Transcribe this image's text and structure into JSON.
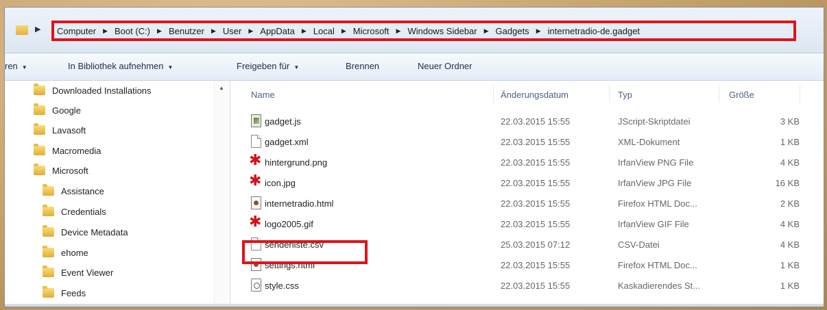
{
  "address_bar": {
    "crumbs": [
      "Computer",
      "Boot (C:)",
      "Benutzer",
      "User",
      "AppData",
      "Local",
      "Microsoft",
      "Windows Sidebar",
      "Gadgets",
      "internetradio-de.gadget"
    ]
  },
  "toolbar": {
    "organize_label": "ren",
    "library_label": "In Bibliothek aufnehmen",
    "share_label": "Freigeben für",
    "burn_label": "Brennen",
    "new_folder_label": "Neuer Ordner"
  },
  "nav": {
    "items": [
      "Downloaded Installations",
      "Google",
      "Lavasoft",
      "Macromedia",
      "Microsoft",
      "Assistance",
      "Credentials",
      "Device Metadata",
      "ehome",
      "Event Viewer",
      "Feeds"
    ]
  },
  "columns": {
    "name": "Name",
    "date": "Änderungsdatum",
    "type": "Typ",
    "size": "Größe"
  },
  "files": [
    {
      "name": "gadget.js",
      "date": "22.03.2015 15:55",
      "type": "JScript-Skriptdatei",
      "size": "3 KB",
      "icon": "script-icon"
    },
    {
      "name": "gadget.xml",
      "date": "22.03.2015 15:55",
      "type": "XML-Dokument",
      "size": "1 KB",
      "icon": "document-icon"
    },
    {
      "name": "hintergrund.png",
      "date": "22.03.2015 15:55",
      "type": "IrfanView PNG File",
      "size": "4 KB",
      "icon": "irfanview-image-icon"
    },
    {
      "name": "icon.jpg",
      "date": "22.03.2015 15:55",
      "type": "IrfanView JPG File",
      "size": "16 KB",
      "icon": "irfanview-image-icon"
    },
    {
      "name": "internetradio.html",
      "date": "22.03.2015 15:55",
      "type": "Firefox HTML Doc...",
      "size": "2 KB",
      "icon": "html-document-icon"
    },
    {
      "name": "logo2005.gif",
      "date": "22.03.2015 15:55",
      "type": "IrfanView GIF File",
      "size": "4 KB",
      "icon": "irfanview-image-icon"
    },
    {
      "name": "senderliste.csv",
      "date": "25.03.2015 07:12",
      "type": "CSV-Datei",
      "size": "4 KB",
      "icon": "document-icon"
    },
    {
      "name": "settings.html",
      "date": "22.03.2015 15:55",
      "type": "Firefox HTML Doc...",
      "size": "1 KB",
      "icon": "html-document-icon"
    },
    {
      "name": "style.css",
      "date": "22.03.2015 15:55",
      "type": "Kaskadierendes St...",
      "size": "1 KB",
      "icon": "css-document-icon"
    }
  ],
  "colors": {
    "highlight_red": "#e0121b",
    "header_text": "#4d6185"
  }
}
